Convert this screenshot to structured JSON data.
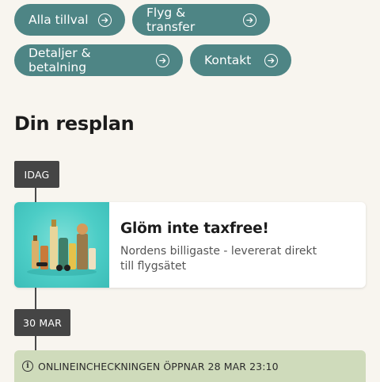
{
  "nav_buttons": [
    {
      "label": "Alla tillval"
    },
    {
      "label": "Flyg & transfer"
    },
    {
      "label": "Detaljer & betalning"
    },
    {
      "label": "Kontakt"
    }
  ],
  "itinerary": {
    "title": "Din resplan",
    "today_tag": "IDAG",
    "promo_card": {
      "title": "Glöm inte taxfree!",
      "subtitle": "Nordens billigaste - levererat direkt till flygsätet",
      "image": "taxfree-products-image"
    },
    "date_tag": "30 MAR",
    "checkin_notice": {
      "icon": "info-icon",
      "text": "ONLINEINCHECKNINGEN ÖPPNAR 28 MAR 23:10"
    }
  },
  "colors": {
    "background": "#f8f5ef",
    "pill": "#4e8585",
    "tag": "#454545",
    "notice": "#cfdbbb",
    "promo_image_bg": "#4ccdc6"
  }
}
